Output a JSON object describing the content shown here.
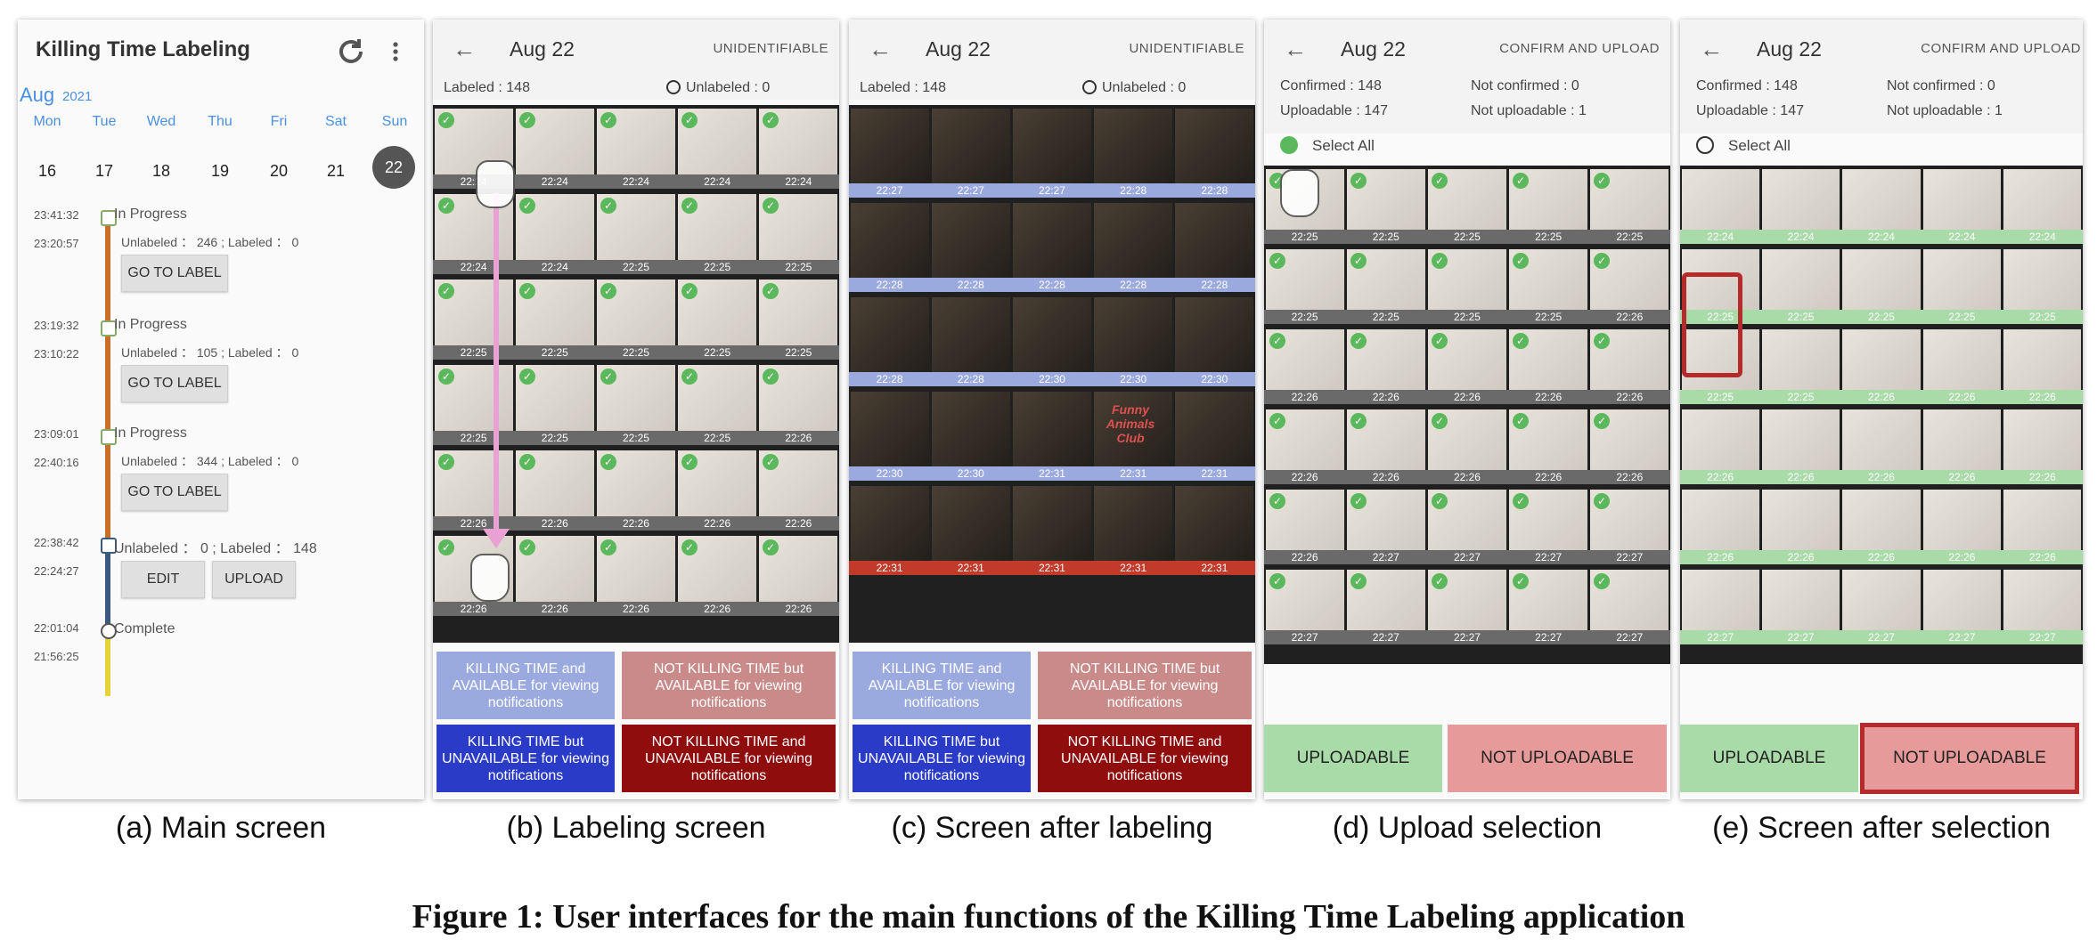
{
  "colors": {
    "blue_light": "#9aa9de",
    "pink_light": "#c98a8a",
    "blue_dark": "#2a3bc8",
    "red_dark": "#8f0d0d",
    "green_light": "#a8dba8",
    "pink_not_upload": "#e79a9a",
    "selection_red": "#b52a2a"
  },
  "figure_title": "Figure 1: User interfaces for the main functions of the Killing Time Labeling application",
  "captions": {
    "a": "(a) Main screen",
    "b": "(b) Labeling screen",
    "c": "(c) Screen after labeling",
    "d": "(d) Upload selection",
    "e": "(e) Screen after selection"
  },
  "main_screen": {
    "title": "Killing Time Labeling",
    "refresh_icon": "refresh-icon",
    "menu_icon": "more-vert-icon",
    "month": "Aug",
    "year": "2021",
    "weekdays": [
      "Mon",
      "Tue",
      "Wed",
      "Thu",
      "Fri",
      "Sat",
      "Sun"
    ],
    "days": [
      "16",
      "17",
      "18",
      "19",
      "20",
      "21",
      "22"
    ],
    "selected_day": "22",
    "sessions": [
      {
        "time_end": "23:41:32",
        "time_start": "23:20:57",
        "status": "In Progress",
        "counts": "Unlabeled ： 246 ; Labeled ： 0",
        "button": "GO TO LABEL"
      },
      {
        "time_end": "23:19:32",
        "time_start": "23:10:22",
        "status": "In Progress",
        "counts": "Unlabeled ： 105 ; Labeled ： 0",
        "button": "GO TO LABEL"
      },
      {
        "time_end": "23:09:01",
        "time_start": "22:40:16",
        "status": "In Progress",
        "counts": "Unlabeled ： 344 ; Labeled ： 0",
        "button": "GO TO LABEL"
      },
      {
        "time_end": "22:38:42",
        "time_start": "22:24:27",
        "counts": "Unlabeled ： 0 ; Labeled ： 148",
        "button_edit": "EDIT",
        "button_upload": "UPLOAD"
      },
      {
        "time_end": "22:01:04",
        "time_start": "21:56:25",
        "status": "Complete"
      }
    ]
  },
  "labeling_screen": {
    "date": "Aug 22",
    "action": "UNIDENTIFIABLE",
    "labeled": "Labeled :   148",
    "unlabeled": "Unlabeled :  0",
    "rows_b": [
      [
        "22:24",
        "22:24",
        "22:24",
        "22:24",
        "22:24"
      ],
      [
        "22:24",
        "22:24",
        "22:25",
        "22:25",
        "22:25"
      ],
      [
        "22:25",
        "22:25",
        "22:25",
        "22:25",
        "22:25"
      ],
      [
        "22:25",
        "22:25",
        "22:25",
        "22:25",
        "22:26"
      ],
      [
        "22:26",
        "22:26",
        "22:26",
        "22:26",
        "22:26"
      ],
      [
        "22:26",
        "22:26",
        "22:26",
        "22:26",
        "22:26"
      ]
    ],
    "buttons": [
      "KILLING TIME and AVAILABLE for viewing notifications",
      "NOT KILLING TIME but AVAILABLE for viewing notifications",
      "KILLING TIME but UNAVAILABLE for viewing notifications",
      "NOT KILLING TIME and UNAVAILABLE for viewing notifications"
    ]
  },
  "after_labeling": {
    "date": "Aug 22",
    "action": "UNIDENTIFIABLE",
    "labeled": "Labeled :   148",
    "unlabeled": "Unlabeled :  0",
    "rows_c": [
      [
        "22:27",
        "22:27",
        "22:27",
        "22:28",
        "22:28"
      ],
      [
        "22:28",
        "22:28",
        "22:28",
        "22:28",
        "22:28"
      ],
      [
        "22:28",
        "22:28",
        "22:30",
        "22:30",
        "22:30"
      ],
      [
        "22:30",
        "22:30",
        "22:31",
        "22:31",
        "22:31"
      ],
      [
        "22:31",
        "22:31",
        "22:31",
        "22:31",
        "22:31"
      ]
    ],
    "funny_label": "Funny Animals Club"
  },
  "upload_selection": {
    "date": "Aug 22",
    "action": "CONFIRM AND UPLOAD",
    "confirmed": "Confirmed :   148",
    "not_confirmed": "Not confirmed :  0",
    "uploadable": "Uploadable :  147",
    "not_uploadable": "Not uploadable :  1",
    "select_all": "Select All",
    "rows_d": [
      [
        "22:25",
        "22:25",
        "22:25",
        "22:25",
        "22:25"
      ],
      [
        "22:25",
        "22:25",
        "22:25",
        "22:25",
        "22:26"
      ],
      [
        "22:26",
        "22:26",
        "22:26",
        "22:26",
        "22:26"
      ],
      [
        "22:26",
        "22:26",
        "22:26",
        "22:26",
        "22:26"
      ],
      [
        "22:26",
        "22:27",
        "22:27",
        "22:27",
        "22:27"
      ],
      [
        "22:27",
        "22:27",
        "22:27",
        "22:27",
        "22:27"
      ]
    ],
    "uploadable_btn": "UPLOADABLE",
    "not_uploadable_btn": "NOT UPLOADABLE"
  },
  "after_selection": {
    "date": "Aug 22",
    "action": "CONFIRM AND UPLOAD",
    "confirmed": "Confirmed :   148",
    "not_confirmed": "Not confirmed :  0",
    "uploadable": "Uploadable :  147",
    "not_uploadable": "Not uploadable :  1",
    "select_all": "Select All",
    "rows_e": [
      [
        "22:24",
        "22:24",
        "22:24",
        "22:24",
        "22:24"
      ],
      [
        "22:25",
        "22:25",
        "22:25",
        "22:25",
        "22:25"
      ],
      [
        "22:25",
        "22:25",
        "22:26",
        "22:26",
        "22:26"
      ],
      [
        "22:26",
        "22:26",
        "22:26",
        "22:26",
        "22:26"
      ],
      [
        "22:26",
        "22:26",
        "22:26",
        "22:26",
        "22:26"
      ],
      [
        "22:27",
        "22:27",
        "22:27",
        "22:27",
        "22:27"
      ]
    ],
    "uploadable_btn": "UPLOADABLE",
    "not_uploadable_btn": "NOT UPLOADABLE"
  }
}
